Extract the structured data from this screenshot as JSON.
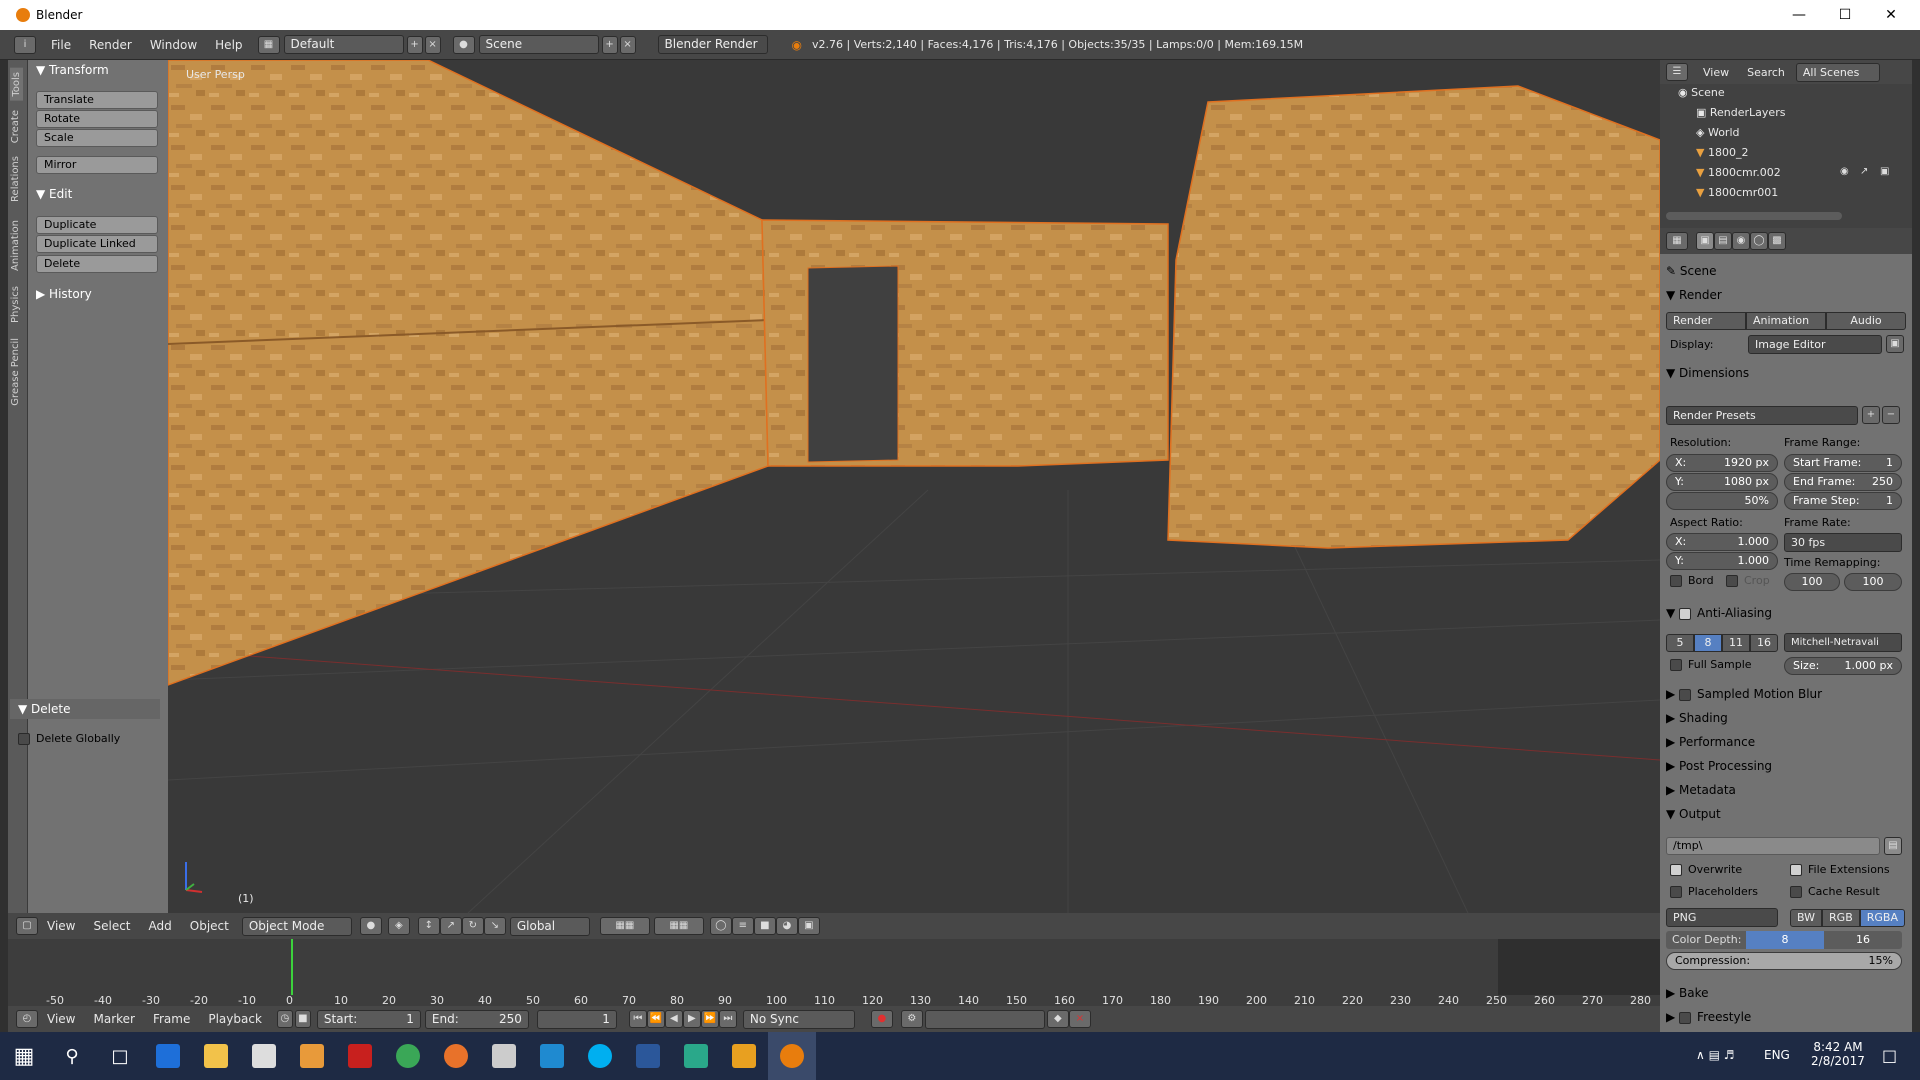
{
  "app": {
    "title": "Blender"
  },
  "menu": {
    "items": [
      "File",
      "Render",
      "Window",
      "Help"
    ],
    "layout": "Default",
    "scene": "Scene",
    "engine": "Blender Render",
    "stats": "v2.76 | Verts:2,140 | Faces:4,176 | Tris:4,176 | Objects:35/35 | Lamps:0/0 | Mem:169.15M"
  },
  "toolshelf": {
    "tabs": [
      "Tools",
      "Create",
      "Relations",
      "Animation",
      "Physics",
      "Grease Pencil"
    ],
    "transform": {
      "title": "Transform",
      "buttons": [
        "Translate",
        "Rotate",
        "Scale",
        "Mirror"
      ]
    },
    "edit": {
      "title": "Edit",
      "buttons": [
        "Duplicate",
        "Duplicate Linked",
        "Delete"
      ]
    },
    "history": {
      "title": "History"
    },
    "delete": {
      "title": "Delete",
      "option": "Delete Globally"
    }
  },
  "viewport": {
    "label": "User Persp",
    "frame": "(1)"
  },
  "vpheader": {
    "items": [
      "View",
      "Select",
      "Add",
      "Object"
    ],
    "mode": "Object Mode",
    "orientation": "Global"
  },
  "timeline": {
    "ticks": [
      "-50",
      "-40",
      "-30",
      "-20",
      "-10",
      "0",
      "10",
      "20",
      "30",
      "40",
      "50",
      "60",
      "70",
      "80",
      "90",
      "100",
      "110",
      "120",
      "130",
      "140",
      "150",
      "160",
      "170",
      "180",
      "190",
      "200",
      "210",
      "220",
      "230",
      "240",
      "250",
      "260",
      "270",
      "280"
    ],
    "menu": [
      "View",
      "Marker",
      "Frame",
      "Playback"
    ],
    "start_label": "Start:",
    "start": "1",
    "end_label": "End:",
    "end": "250",
    "current": "1",
    "sync": "No Sync"
  },
  "outliner": {
    "menu": [
      "View",
      "Search"
    ],
    "filter": "All Scenes",
    "items": [
      "Scene",
      "RenderLayers",
      "World",
      "1800_2",
      "1800cmr.002",
      "1800cmr001"
    ]
  },
  "props": {
    "scene": "Scene",
    "render_title": "Render",
    "tabs": [
      "Render",
      "Animation",
      "Audio"
    ],
    "display_label": "Display:",
    "display": "Image Editor",
    "dimensions": "Dimensions",
    "presets": "Render Presets",
    "resolution_label": "Resolution:",
    "res_x": "X:",
    "res_x_val": "1920 px",
    "res_y": "Y:",
    "res_y_val": "1080 px",
    "res_pct": "50%",
    "frame_range_label": "Frame Range:",
    "start_frame": "Start Frame:",
    "start_frame_val": "1",
    "end_frame": "End Frame:",
    "end_frame_val": "250",
    "frame_step": "Frame Step:",
    "frame_step_val": "1",
    "aspect_label": "Aspect Ratio:",
    "asp_x": "X:",
    "asp_x_val": "1.000",
    "asp_y": "Y:",
    "asp_y_val": "1.000",
    "frame_rate_label": "Frame Rate:",
    "frame_rate": "30 fps",
    "time_remap_label": "Time Remapping:",
    "remap_old": "100",
    "remap_new": "100",
    "bord": "Bord",
    "crop": "Crop",
    "aa_title": "Anti-Aliasing",
    "aa_samples": [
      "5",
      "8",
      "11",
      "16"
    ],
    "aa_filter": "Mitchell-Netravali",
    "full_sample": "Full Sample",
    "size_label": "Size:",
    "size_val": "1.000 px",
    "collapsed": [
      "Sampled Motion Blur",
      "Shading",
      "Performance",
      "Post Processing",
      "Metadata"
    ],
    "output_title": "Output",
    "output_path": "/tmp\\",
    "overwrite": "Overwrite",
    "file_ext": "File Extensions",
    "placeholders": "Placeholders",
    "cache": "Cache Result",
    "format": "PNG",
    "color_modes": [
      "BW",
      "RGB",
      "RGBA"
    ],
    "color_depth_label": "Color Depth:",
    "depth_8": "8",
    "depth_16": "16",
    "compression_label": "Compression:",
    "compression_val": "15%",
    "bake": "Bake",
    "freestyle": "Freestyle"
  },
  "taskbar": {
    "lang": "ENG",
    "time": "8:42 AM",
    "date": "2/8/2017"
  }
}
